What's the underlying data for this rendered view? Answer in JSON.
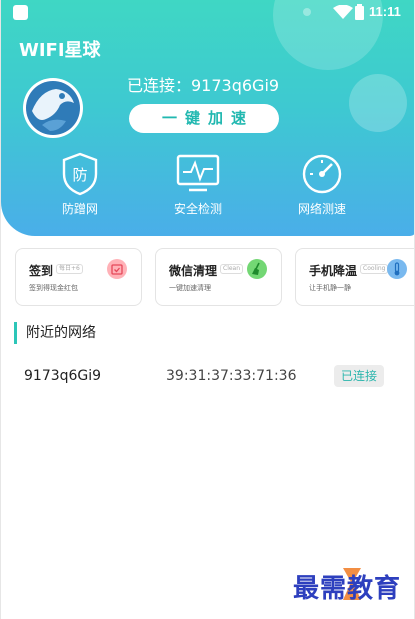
{
  "status_bar": {
    "time": "11:11"
  },
  "app": {
    "title": "WIFI星球"
  },
  "connection": {
    "text": "已连接：9173q6Gi9",
    "speed_button": "一键加速"
  },
  "features": [
    {
      "label": "防蹭网",
      "icon": "shield-icon",
      "glyph": "防"
    },
    {
      "label": "安全检测",
      "icon": "monitor-icon"
    },
    {
      "label": "网络测速",
      "icon": "speedometer-icon"
    }
  ],
  "cards": [
    {
      "title": "签到",
      "tag": "每日+6",
      "subtitle": "签到得现金红包",
      "icon": "calendar-icon"
    },
    {
      "title": "微信清理",
      "tag": "Clean",
      "subtitle": "一键加速清理",
      "icon": "broom-icon"
    },
    {
      "title": "手机降温",
      "tag": "Cooling",
      "subtitle": "让手机静一静",
      "icon": "thermometer-icon"
    }
  ],
  "nearby": {
    "title": "附近的网络",
    "networks": [
      {
        "ssid": "9173q6Gi9",
        "mac": "39:31:37:33:71:36",
        "status": "已连接"
      }
    ]
  },
  "watermark": {
    "text": "最需教育"
  },
  "colors": {
    "accent": "#2cc6b8",
    "gradient_top": "#3fd7c4",
    "gradient_bottom": "#4aaee9"
  }
}
